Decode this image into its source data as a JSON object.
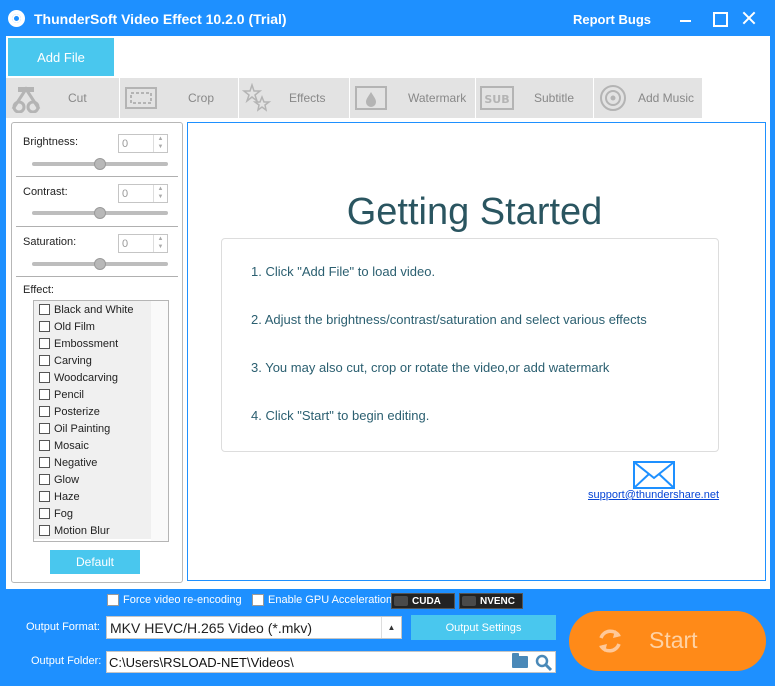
{
  "window": {
    "title": "ThunderSoft Video Effect 10.2.0 (Trial)",
    "report_bugs": "Report Bugs"
  },
  "add_file": "Add File",
  "toolbar": {
    "items": [
      {
        "label": "Cut",
        "icon": "cut-icon"
      },
      {
        "label": "Crop",
        "icon": "crop-icon"
      },
      {
        "label": "Effects",
        "icon": "effects-icon"
      },
      {
        "label": "Watermark",
        "icon": "watermark-icon"
      },
      {
        "label": "Subtitle",
        "icon": "subtitle-icon"
      },
      {
        "label": "Add Music",
        "icon": "music-icon"
      }
    ]
  },
  "adjust": {
    "brightness": {
      "label": "Brightness:",
      "value": "0",
      "level": 0.5
    },
    "contrast": {
      "label": "Contrast:",
      "value": "0",
      "level": 0.5
    },
    "saturation": {
      "label": "Saturation:",
      "value": "0",
      "level": 0.5
    }
  },
  "effects": {
    "label": "Effect:",
    "items": [
      "Black and White",
      "Old Film",
      "Embossment",
      "Carving",
      "Woodcarving",
      "Pencil",
      "Posterize",
      "Oil Painting",
      "Mosaic",
      "Negative",
      "Glow",
      "Haze",
      "Fog",
      "Motion Blur"
    ],
    "default_label": "Default"
  },
  "getting_started": {
    "title": "Getting Started",
    "steps": [
      "1. Click \"Add File\" to load video.",
      "2. Adjust the brightness/contrast/saturation and select various effects",
      "3. You may also cut, crop or rotate the video,or add watermark",
      "4. Click \"Start\" to begin editing."
    ],
    "support_email": "support@thundershare.net"
  },
  "output": {
    "force_reencoding": "Force video re-encoding",
    "gpu_acceleration": "Enable GPU Acceleration",
    "cuda": "CUDA",
    "nvenc": "NVENC",
    "format_label": "Output Format:",
    "format_value": "MKV HEVC/H.265 Video (*.mkv)",
    "settings_label": "Output Settings",
    "folder_label": "Output Folder:",
    "folder_value": "C:\\Users\\RSLOAD-NET\\Videos\\"
  },
  "start_label": "Start",
  "colors": {
    "accent_blue": "#1e90ff",
    "button_cyan": "#49c7ee",
    "start_orange": "#ff8a18"
  }
}
